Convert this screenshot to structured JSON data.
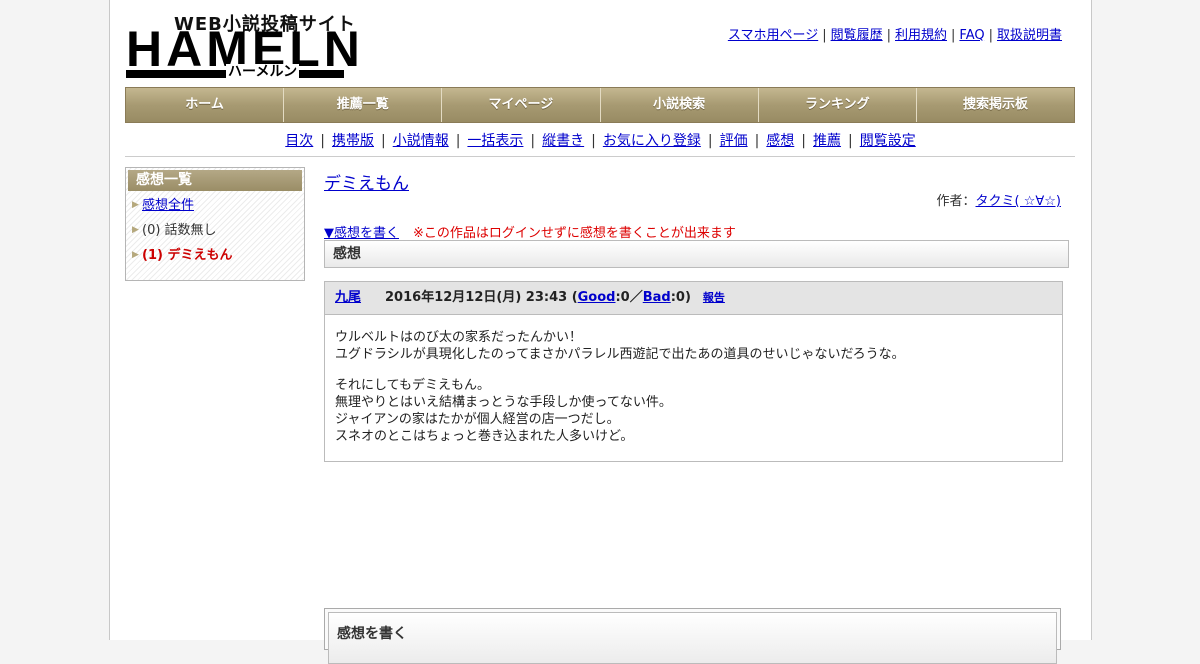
{
  "logo": {
    "tagline": "WEB小説投稿サイト",
    "wordmark": "HAMELN",
    "kana": "ハーメルン"
  },
  "top_links": [
    "スマホ用ページ",
    "閲覧履歴",
    "利用規約",
    "FAQ",
    "取扱説明書"
  ],
  "nav": [
    "ホーム",
    "推薦一覧",
    "マイページ",
    "小説検索",
    "ランキング",
    "捜索掲示板"
  ],
  "subnav": [
    "目次",
    "携帯版",
    "小説情報",
    "一括表示",
    "縦書き",
    "お気に入り登録",
    "評価",
    "感想",
    "推薦",
    "閲覧設定"
  ],
  "sidebar": {
    "title": "感想一覧",
    "items": [
      {
        "label": "感想全件",
        "link": true
      },
      {
        "label": "(0) 話数無し",
        "link": false
      },
      {
        "label": "(1) デミえもん",
        "link": false,
        "current": true
      }
    ]
  },
  "main": {
    "title": "デミえもん",
    "author_prefix": "作者：",
    "author_name": "タクミ( ☆∀☆)",
    "write_link": "▼感想を書く",
    "write_note": "※この作品はログインせずに感想を書くことが出来ます",
    "section_heading": "感想",
    "comment": {
      "user": "九尾",
      "datetime": "2016年12月12日(月) 23:43 (",
      "good_label": "Good",
      "good_count": ":0／",
      "bad_label": "Bad",
      "bad_count": ":0)",
      "report": "報告",
      "para1_line1": "ウルベルトはのび太の家系だったんかい！",
      "para1_line2": "ユグドラシルが具現化したのってまさかパラレル西遊記で出たあの道具のせいじゃないだろうな。",
      "para2_line1": "それにしてもデミえもん。",
      "para2_line2": "無理やりとはいえ結構まっとうな手段しか使ってない件。",
      "para2_line3": "ジャイアンの家はたかが個人経営の店一つだし。",
      "para2_line4": "スネオのとこはちょっと巻き込まれた人多いけど。"
    },
    "bottom_heading": "感想を書く"
  }
}
